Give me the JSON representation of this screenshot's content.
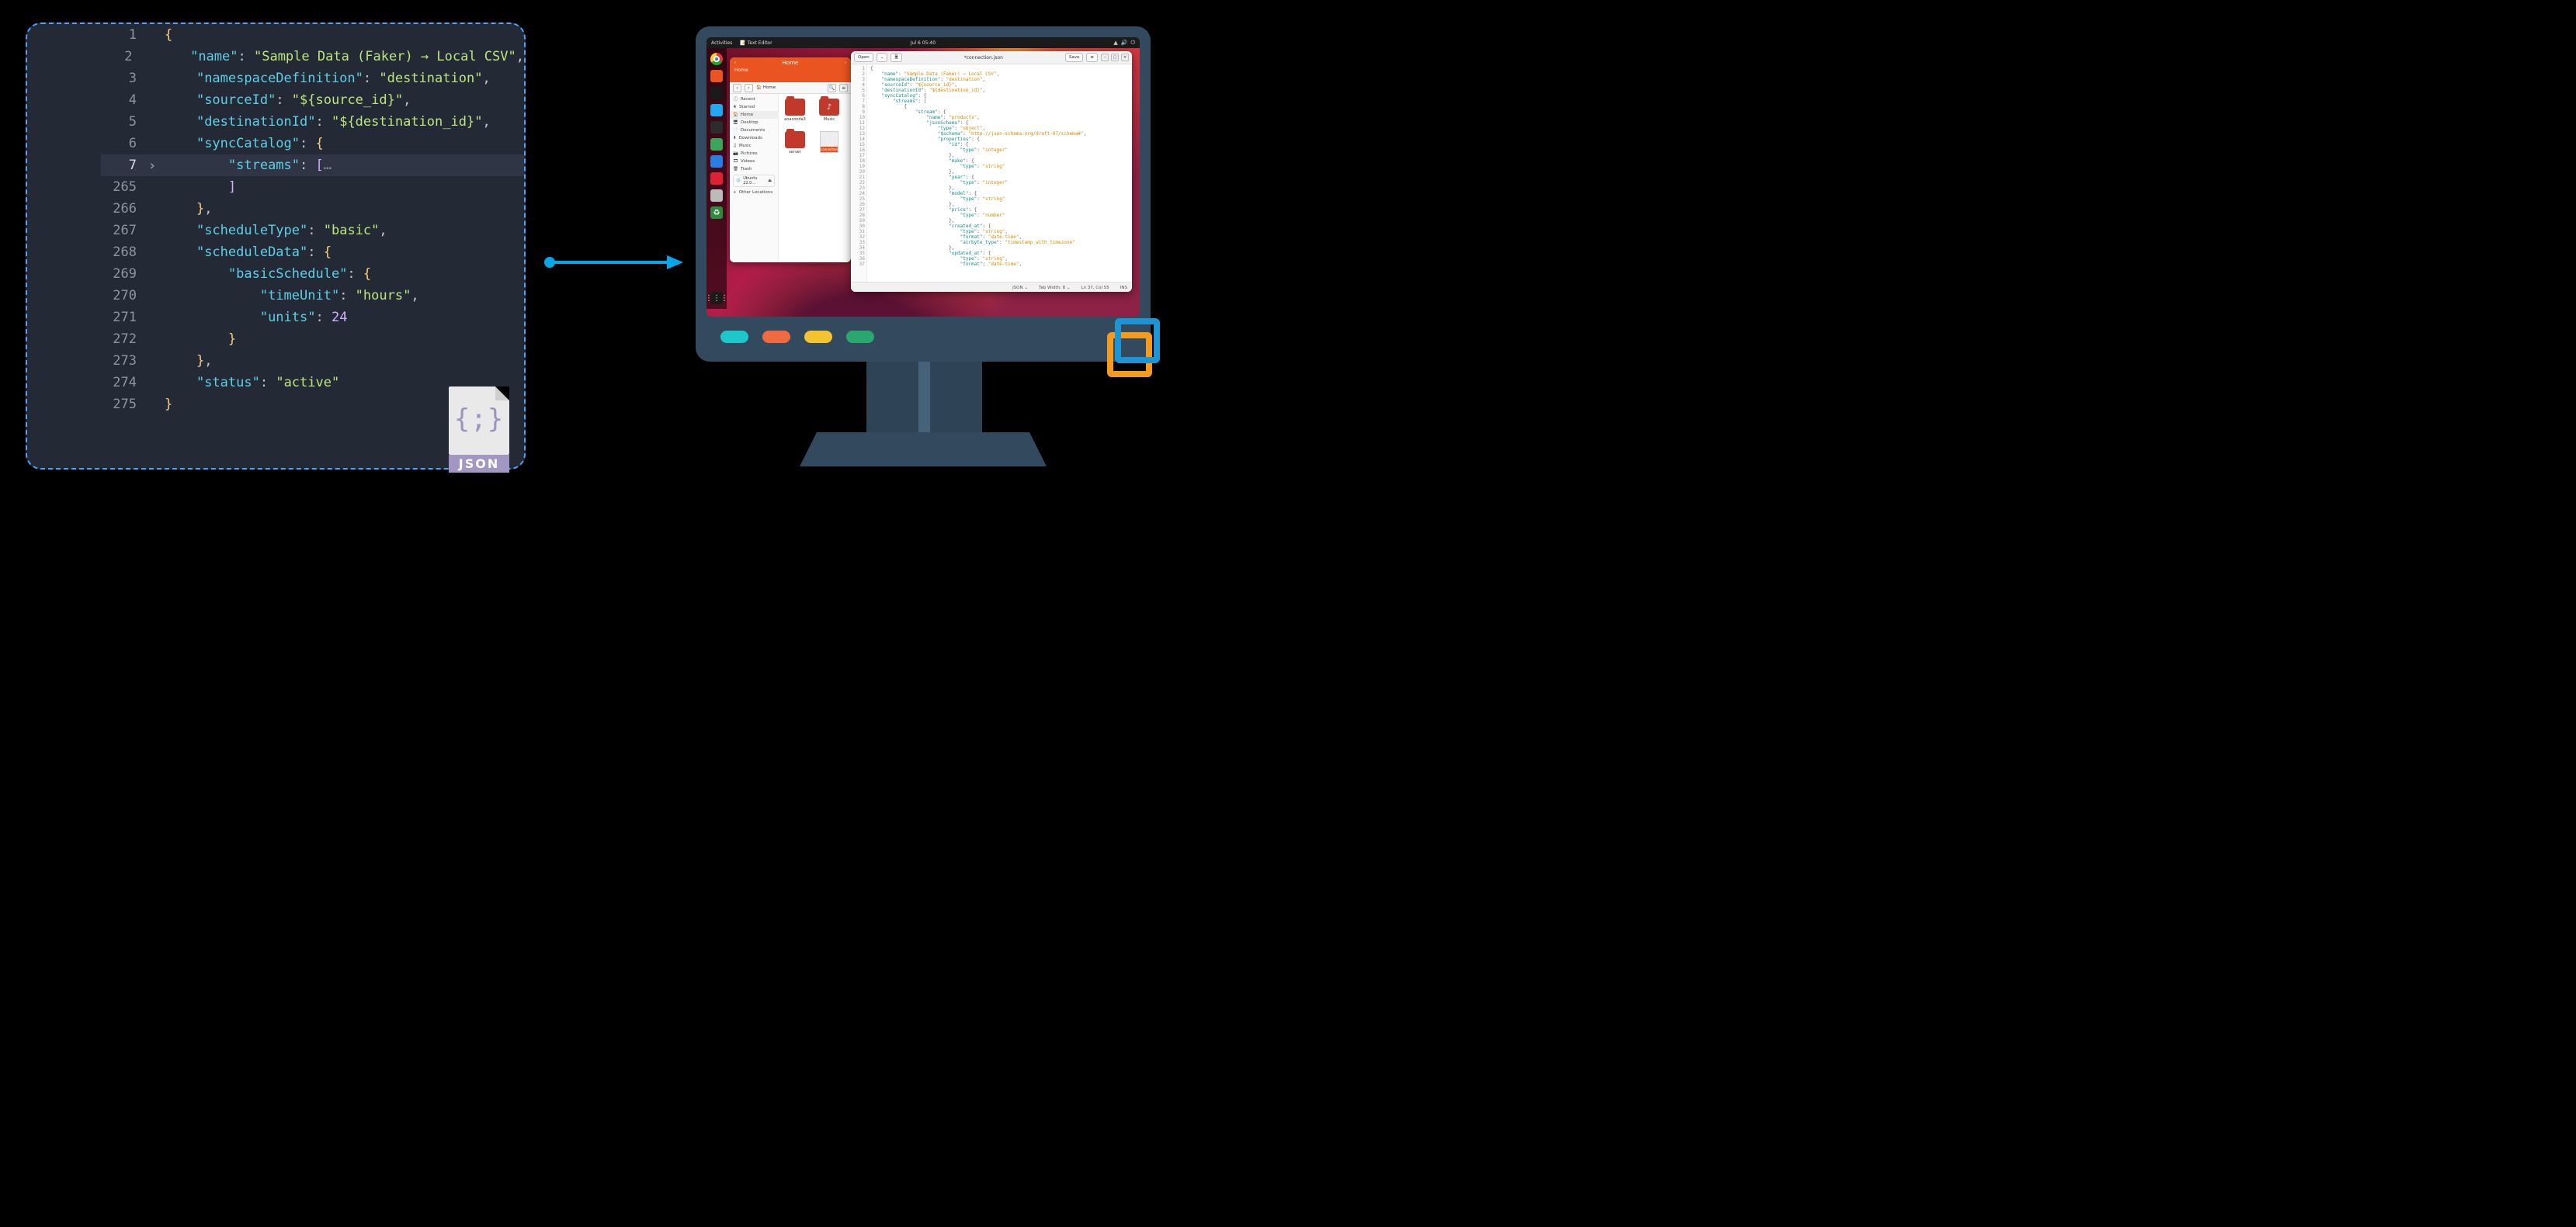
{
  "left_editor": {
    "badge_label": "JSON",
    "lines": [
      {
        "n": 1,
        "fold": "",
        "indent": 0,
        "tokens": [
          [
            "brace",
            "{"
          ]
        ]
      },
      {
        "n": 2,
        "fold": "",
        "indent": 1,
        "tokens": [
          [
            "key",
            "\"name\""
          ],
          [
            "colon",
            ": "
          ],
          [
            "str",
            "\"Sample Data (Faker) → Local CSV\""
          ],
          [
            "punct",
            ","
          ]
        ]
      },
      {
        "n": 3,
        "fold": "",
        "indent": 1,
        "tokens": [
          [
            "key",
            "\"namespaceDefinition\""
          ],
          [
            "colon",
            ": "
          ],
          [
            "str",
            "\"destination\""
          ],
          [
            "punct",
            ","
          ]
        ]
      },
      {
        "n": 4,
        "fold": "",
        "indent": 1,
        "tokens": [
          [
            "key",
            "\"sourceId\""
          ],
          [
            "colon",
            ": "
          ],
          [
            "str",
            "\"${source_id}\""
          ],
          [
            "punct",
            ","
          ]
        ]
      },
      {
        "n": 5,
        "fold": "",
        "indent": 1,
        "tokens": [
          [
            "key",
            "\"destinationId\""
          ],
          [
            "colon",
            ": "
          ],
          [
            "str",
            "\"${destination_id}\""
          ],
          [
            "punct",
            ","
          ]
        ]
      },
      {
        "n": 6,
        "fold": "",
        "indent": 1,
        "tokens": [
          [
            "key",
            "\"syncCatalog\""
          ],
          [
            "colon",
            ": "
          ],
          [
            "brace",
            "{"
          ]
        ]
      },
      {
        "n": 7,
        "fold": ">",
        "indent": 2,
        "active": true,
        "tokens": [
          [
            "key",
            "\"streams\""
          ],
          [
            "colon",
            ": "
          ],
          [
            "brk",
            "["
          ],
          [
            "dots",
            "…"
          ]
        ]
      },
      {
        "n": 265,
        "fold": "",
        "indent": 2,
        "tokens": [
          [
            "brk",
            "]"
          ]
        ]
      },
      {
        "n": 266,
        "fold": "",
        "indent": 1,
        "tokens": [
          [
            "brace",
            "}"
          ],
          [
            "punct",
            ","
          ]
        ]
      },
      {
        "n": 267,
        "fold": "",
        "indent": 1,
        "tokens": [
          [
            "key",
            "\"scheduleType\""
          ],
          [
            "colon",
            ": "
          ],
          [
            "str",
            "\"basic\""
          ],
          [
            "punct",
            ","
          ]
        ]
      },
      {
        "n": 268,
        "fold": "",
        "indent": 1,
        "tokens": [
          [
            "key",
            "\"scheduleData\""
          ],
          [
            "colon",
            ": "
          ],
          [
            "brace",
            "{"
          ]
        ]
      },
      {
        "n": 269,
        "fold": "",
        "indent": 2,
        "tokens": [
          [
            "key",
            "\"basicSchedule\""
          ],
          [
            "colon",
            ": "
          ],
          [
            "brace",
            "{"
          ]
        ]
      },
      {
        "n": 270,
        "fold": "",
        "indent": 3,
        "tokens": [
          [
            "key",
            "\"timeUnit\""
          ],
          [
            "colon",
            ": "
          ],
          [
            "str",
            "\"hours\""
          ],
          [
            "punct",
            ","
          ]
        ]
      },
      {
        "n": 271,
        "fold": "",
        "indent": 3,
        "tokens": [
          [
            "key",
            "\"units\""
          ],
          [
            "colon",
            ": "
          ],
          [
            "num",
            "24"
          ]
        ]
      },
      {
        "n": 272,
        "fold": "",
        "indent": 2,
        "tokens": [
          [
            "brace",
            "}"
          ]
        ]
      },
      {
        "n": 273,
        "fold": "",
        "indent": 1,
        "tokens": [
          [
            "brace",
            "}"
          ],
          [
            "punct",
            ","
          ]
        ]
      },
      {
        "n": 274,
        "fold": "",
        "indent": 1,
        "tokens": [
          [
            "key",
            "\"status\""
          ],
          [
            "colon",
            ": "
          ],
          [
            "str",
            "\"active\""
          ]
        ]
      },
      {
        "n": 275,
        "fold": "",
        "indent": 0,
        "tokens": [
          [
            "brace",
            "}"
          ]
        ]
      }
    ]
  },
  "leds": [
    {
      "color": "#1ec8c8"
    },
    {
      "color": "#f06a3f"
    },
    {
      "color": "#f4c430"
    },
    {
      "color": "#2aa66f"
    }
  ],
  "ubuntu": {
    "topbar": {
      "activities": "Activities",
      "app": "Text Editor",
      "clock": "Jul 6  05:40"
    },
    "dock_apps_grid": "⋮⋮⋮"
  },
  "nautilus": {
    "header": {
      "title": "Home",
      "back": "‹",
      "fwd": "›"
    },
    "path": {
      "home_label": "Home",
      "search": "🔍",
      "menu": "≡"
    },
    "sidebar": [
      {
        "icon": "🕘",
        "label": "Recent"
      },
      {
        "icon": "★",
        "label": "Starred"
      },
      {
        "icon": "🏠",
        "label": "Home",
        "active": true
      },
      {
        "icon": "🖥",
        "label": "Desktop"
      },
      {
        "icon": "📄",
        "label": "Documents"
      },
      {
        "icon": "⬇",
        "label": "Downloads"
      },
      {
        "icon": "♫",
        "label": "Music"
      },
      {
        "icon": "📷",
        "label": "Pictures"
      },
      {
        "icon": "🎞",
        "label": "Videos"
      },
      {
        "icon": "🗑",
        "label": "Trash"
      }
    ],
    "sidebar_drive": {
      "label": "Ubuntu 22.0…",
      "eject": "⏏"
    },
    "sidebar_other": {
      "icon": "+",
      "label": "Other Locations"
    },
    "grid": [
      {
        "type": "folder",
        "label": "anaconda3"
      },
      {
        "type": "folder",
        "label": "Music",
        "music": true
      },
      {
        "type": "folder",
        "label": "server"
      },
      {
        "type": "file",
        "label": "connection.json",
        "tag": "connection.json"
      }
    ]
  },
  "gedit": {
    "header": {
      "open": "Open",
      "open_arrow": "⌄",
      "new": "🗎",
      "title": "*connection.json",
      "save": "Save",
      "menu": "≡",
      "min": "–",
      "max": "▢",
      "close": "×"
    },
    "statusbar": {
      "lang": "JSON ⌄",
      "tab": "Tab Width: 8 ⌄",
      "pos": "Ln 37, Col 55",
      "ins": "INS"
    },
    "lines": [
      {
        "n": 1,
        "i": 0,
        "t": [
          [
            "p",
            "{"
          ]
        ]
      },
      {
        "n": 2,
        "i": 1,
        "t": [
          [
            "k",
            "\"name\""
          ],
          [
            "p",
            ": "
          ],
          [
            "s",
            "\"Sample Data (Faker) → Local CSV\""
          ],
          [
            "p",
            ","
          ]
        ]
      },
      {
        "n": 3,
        "i": 1,
        "t": [
          [
            "k",
            "\"namespaceDefinition\""
          ],
          [
            "p",
            ": "
          ],
          [
            "s",
            "\"destination\""
          ],
          [
            "p",
            ","
          ]
        ]
      },
      {
        "n": 4,
        "i": 1,
        "t": [
          [
            "k",
            "\"sourceId\""
          ],
          [
            "p",
            ": "
          ],
          [
            "s",
            "\"${source_id}\""
          ],
          [
            "p",
            ","
          ]
        ]
      },
      {
        "n": 5,
        "i": 1,
        "t": [
          [
            "k",
            "\"destinationId\""
          ],
          [
            "p",
            ": "
          ],
          [
            "s",
            "\"${destination_id}\""
          ],
          [
            "p",
            ","
          ]
        ]
      },
      {
        "n": 6,
        "i": 1,
        "t": [
          [
            "k",
            "\"syncCatalog\""
          ],
          [
            "p",
            ": {"
          ]
        ]
      },
      {
        "n": 7,
        "i": 2,
        "t": [
          [
            "k",
            "\"streams\""
          ],
          [
            "p",
            ": ["
          ]
        ]
      },
      {
        "n": 8,
        "i": 3,
        "t": [
          [
            "p",
            "{"
          ]
        ]
      },
      {
        "n": 9,
        "i": 4,
        "t": [
          [
            "k",
            "\"stream\""
          ],
          [
            "p",
            ": {"
          ]
        ]
      },
      {
        "n": 10,
        "i": 5,
        "t": [
          [
            "k",
            "\"name\""
          ],
          [
            "p",
            ": "
          ],
          [
            "s",
            "\"products\""
          ],
          [
            "p",
            ","
          ]
        ]
      },
      {
        "n": 11,
        "i": 5,
        "t": [
          [
            "k",
            "\"jsonSchema\""
          ],
          [
            "p",
            ": {"
          ]
        ]
      },
      {
        "n": 12,
        "i": 6,
        "t": [
          [
            "k",
            "\"type\""
          ],
          [
            "p",
            ": "
          ],
          [
            "s",
            "\"object\""
          ],
          [
            "p",
            ","
          ]
        ]
      },
      {
        "n": 13,
        "i": 6,
        "t": [
          [
            "k",
            "\"$schema\""
          ],
          [
            "p",
            ": "
          ],
          [
            "s",
            "\"http://json-schema.org/draft-07/schema#\""
          ],
          [
            "p",
            ","
          ]
        ]
      },
      {
        "n": 14,
        "i": 6,
        "t": [
          [
            "k",
            "\"properties\""
          ],
          [
            "p",
            ": {"
          ]
        ]
      },
      {
        "n": 15,
        "i": 7,
        "t": [
          [
            "k",
            "\"id\""
          ],
          [
            "p",
            ": {"
          ]
        ]
      },
      {
        "n": 16,
        "i": 8,
        "t": [
          [
            "k",
            "\"type\""
          ],
          [
            "p",
            ": "
          ],
          [
            "s",
            "\"integer\""
          ]
        ]
      },
      {
        "n": 17,
        "i": 7,
        "t": [
          [
            "p",
            "},"
          ]
        ]
      },
      {
        "n": 18,
        "i": 7,
        "t": [
          [
            "k",
            "\"make\""
          ],
          [
            "p",
            ": {"
          ]
        ]
      },
      {
        "n": 19,
        "i": 8,
        "t": [
          [
            "k",
            "\"type\""
          ],
          [
            "p",
            ": "
          ],
          [
            "s",
            "\"string\""
          ]
        ]
      },
      {
        "n": 20,
        "i": 7,
        "t": [
          [
            "p",
            "},"
          ]
        ]
      },
      {
        "n": 21,
        "i": 7,
        "t": [
          [
            "k",
            "\"year\""
          ],
          [
            "p",
            ": {"
          ]
        ]
      },
      {
        "n": 22,
        "i": 8,
        "t": [
          [
            "k",
            "\"type\""
          ],
          [
            "p",
            ": "
          ],
          [
            "s",
            "\"integer\""
          ]
        ]
      },
      {
        "n": 23,
        "i": 7,
        "t": [
          [
            "p",
            "},"
          ]
        ]
      },
      {
        "n": 24,
        "i": 7,
        "t": [
          [
            "k",
            "\"model\""
          ],
          [
            "p",
            ": {"
          ]
        ]
      },
      {
        "n": 25,
        "i": 8,
        "t": [
          [
            "k",
            "\"type\""
          ],
          [
            "p",
            ": "
          ],
          [
            "s",
            "\"string\""
          ]
        ]
      },
      {
        "n": 26,
        "i": 7,
        "t": [
          [
            "p",
            "},"
          ]
        ]
      },
      {
        "n": 27,
        "i": 7,
        "t": [
          [
            "k",
            "\"price\""
          ],
          [
            "p",
            ": {"
          ]
        ]
      },
      {
        "n": 28,
        "i": 8,
        "t": [
          [
            "k",
            "\"type\""
          ],
          [
            "p",
            ": "
          ],
          [
            "s",
            "\"number\""
          ]
        ]
      },
      {
        "n": 29,
        "i": 7,
        "t": [
          [
            "p",
            "},"
          ]
        ]
      },
      {
        "n": 30,
        "i": 7,
        "t": [
          [
            "k",
            "\"created_at\""
          ],
          [
            "p",
            ": {"
          ]
        ]
      },
      {
        "n": 31,
        "i": 8,
        "t": [
          [
            "k",
            "\"type\""
          ],
          [
            "p",
            ": "
          ],
          [
            "s",
            "\"string\""
          ],
          [
            "p",
            ","
          ]
        ]
      },
      {
        "n": 32,
        "i": 8,
        "t": [
          [
            "k",
            "\"format\""
          ],
          [
            "p",
            ": "
          ],
          [
            "s",
            "\"date-time\""
          ],
          [
            "p",
            ","
          ]
        ]
      },
      {
        "n": 33,
        "i": 8,
        "t": [
          [
            "k",
            "\"airbyte_type\""
          ],
          [
            "p",
            ": "
          ],
          [
            "s",
            "\"timestamp_with_timezone\""
          ]
        ]
      },
      {
        "n": 34,
        "i": 7,
        "t": [
          [
            "p",
            "},"
          ]
        ]
      },
      {
        "n": 35,
        "i": 7,
        "t": [
          [
            "k",
            "\"updated_at\""
          ],
          [
            "p",
            ": {"
          ]
        ]
      },
      {
        "n": 36,
        "i": 8,
        "t": [
          [
            "k",
            "\"type\""
          ],
          [
            "p",
            ": "
          ],
          [
            "s",
            "\"string\""
          ],
          [
            "p",
            ","
          ]
        ]
      },
      {
        "n": 37,
        "i": 8,
        "t": [
          [
            "k",
            "\"format\""
          ],
          [
            "p",
            ": "
          ],
          [
            "s",
            "\"date-time\""
          ],
          [
            "p",
            ","
          ]
        ]
      }
    ]
  }
}
